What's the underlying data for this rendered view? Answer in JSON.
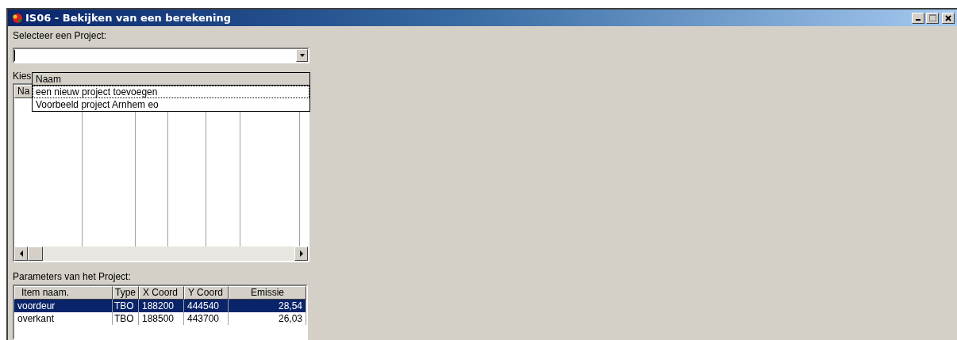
{
  "window": {
    "title": "IS06 - Bekijken van een berekening"
  },
  "project_select": {
    "label": "Selecteer een Project:",
    "expanded": true,
    "dropdown": {
      "header": "Naam",
      "items": [
        {
          "label": "een nieuw project toevoegen",
          "selected": true
        },
        {
          "label": "Voorbeeld project Arnhem eo",
          "selected": false
        }
      ]
    }
  },
  "calculation_list": {
    "label": "Kies",
    "columns": [
      "Na"
    ]
  },
  "parameters": {
    "label": "Parameters van het Project:",
    "columns": [
      "Item naam.",
      "Type",
      "X Coord",
      "Y Coord",
      "Emissie"
    ],
    "rows": [
      {
        "cells": [
          "voordeur",
          "TBO",
          "188200",
          "444540",
          "28,54"
        ],
        "selected": true
      },
      {
        "cells": [
          "overkant",
          "TBO",
          "188500",
          "443700",
          "26,03"
        ],
        "selected": false
      }
    ]
  }
}
